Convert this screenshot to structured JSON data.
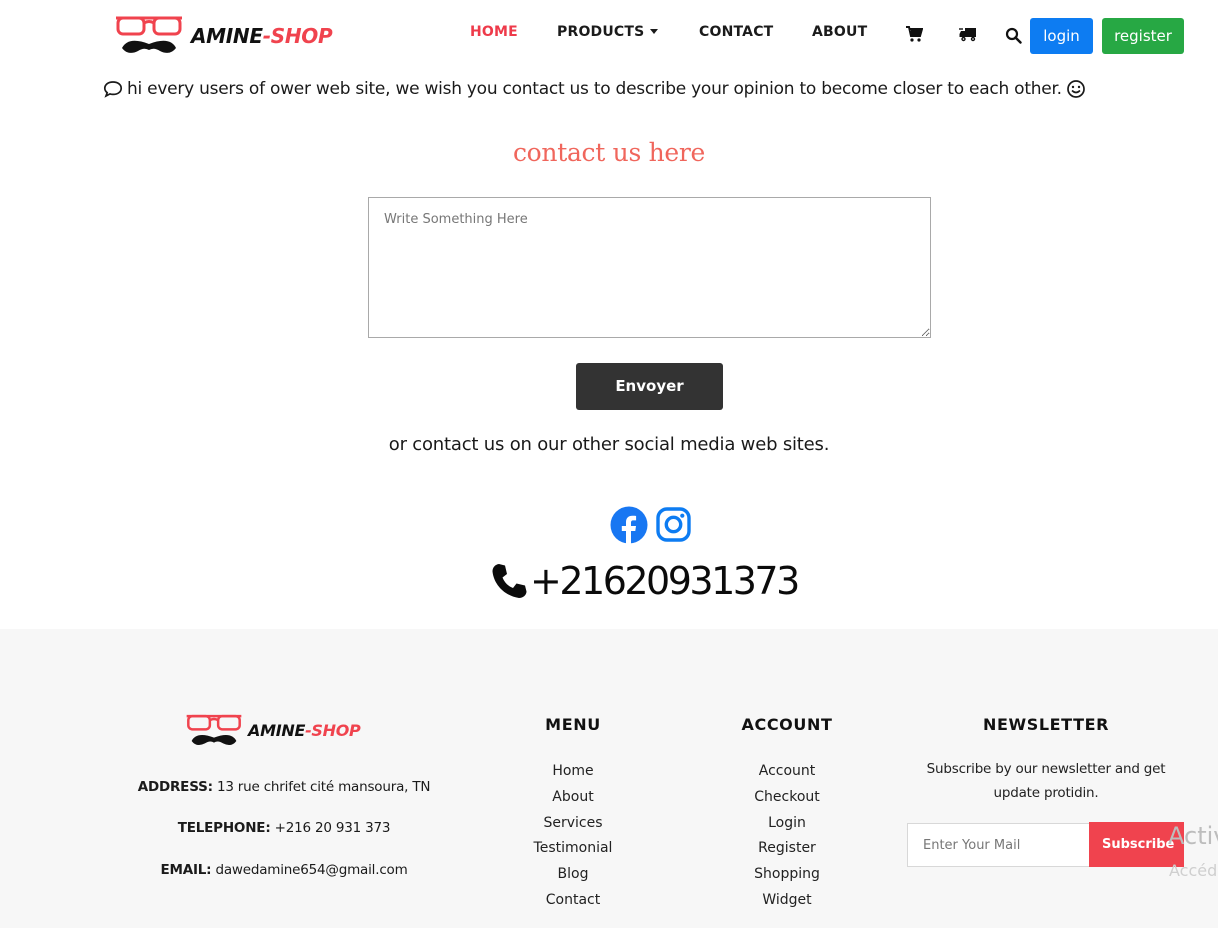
{
  "brand": {
    "name_part1": "AMINE",
    "name_part2": "-SHOP",
    "logo_icon": "glasses-mustache-logo"
  },
  "nav": {
    "home": "HOME",
    "products": "PRODUCTS",
    "contact": "CONTACT",
    "about": "ABOUT",
    "icons": [
      "cart-icon",
      "delivery-truck-icon",
      "search-icon"
    ],
    "login": "login",
    "register": "register"
  },
  "colors": {
    "accent": "#ee3a4a",
    "login_button": "#0d7cf2",
    "register_button": "#27a844",
    "send_button": "#333333",
    "title": "#f0665c",
    "footer_bg": "#f7f7f7",
    "facebook": "#1877f2",
    "instagram": "#0d7cf2"
  },
  "welcome": {
    "text": "hi every users of ower web site, we wish you contact us to describe your opinion to become closer to each other.",
    "icon_left": "speech-bubble-icon",
    "icon_right": "smiley-icon"
  },
  "contact": {
    "title": "contact us here",
    "message_placeholder": "Write Something Here",
    "send_label": "Envoyer",
    "social_text": "or contact us on our other social media web sites.",
    "social_icons": [
      "facebook-icon",
      "instagram-icon"
    ],
    "phone": "+21620931373"
  },
  "footer": {
    "address_label": "ADDRESS:",
    "address_value": "13 rue chrifet cité mansoura, TN",
    "telephone_label": "TELEPHONE:",
    "telephone_value": "+216 20 931 373",
    "email_label": "EMAIL:",
    "email_value": "dawedamine654@gmail.com",
    "menu": {
      "title": "MENU",
      "items": [
        "Home",
        "About",
        "Services",
        "Testimonial",
        "Blog",
        "Contact"
      ]
    },
    "account": {
      "title": "ACCOUNT",
      "items": [
        "Account",
        "Checkout",
        "Login",
        "Register",
        "Shopping",
        "Widget"
      ]
    },
    "newsletter": {
      "title": "NEWSLETTER",
      "text": "Subscribe by our newsletter and get update protidin.",
      "placeholder": "Enter Your Mail",
      "button": "Subscribe"
    }
  },
  "overlay": {
    "activate_line1": "Activ",
    "activate_line2": "Accéd"
  }
}
